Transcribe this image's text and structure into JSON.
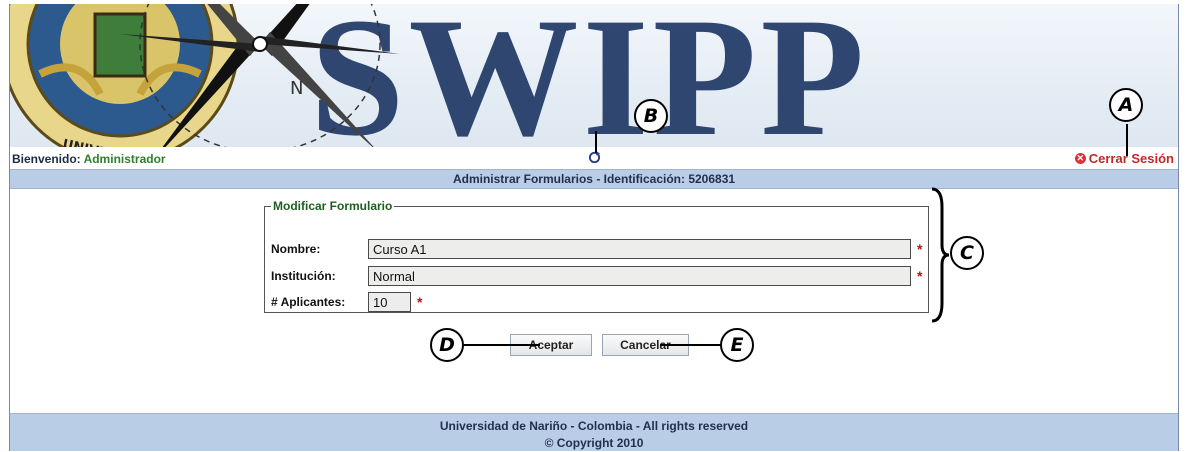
{
  "banner": {
    "logo_text": "SWIPP",
    "seal_text": "UNIVERSIDAD DE NARIÑO"
  },
  "header": {
    "welcome_label": "Bienvenido:",
    "user_name": "Administrador",
    "logout_label": "Cerrar Sesión",
    "icons": {
      "refresh": "refresh-icon",
      "logout": "close-circle-icon"
    }
  },
  "title_bar": {
    "text": "Administrar Formularios - Identificación: 5206831"
  },
  "form": {
    "legend": "Modificar Formulario",
    "fields": [
      {
        "label": "Nombre:",
        "value": "Curso A1",
        "required_mark": "*"
      },
      {
        "label": "Institución:",
        "value": "Normal",
        "required_mark": "*"
      },
      {
        "label": "# Aplicantes:",
        "value": "10",
        "required_mark": "*"
      }
    ]
  },
  "buttons": {
    "accept": "Aceptar",
    "cancel": "Cancelar"
  },
  "footer": {
    "line1": "Universidad de Nariño - Colombia - All rights reserved",
    "line2": "© Copyright 2010"
  },
  "annotations": {
    "a": "A",
    "b": "B",
    "c": "C",
    "d": "D",
    "e": "E"
  },
  "colors": {
    "header_bar": "#b9cde6",
    "logout": "#c0282a",
    "user": "#2f7f2f",
    "logo": "#28406c"
  }
}
